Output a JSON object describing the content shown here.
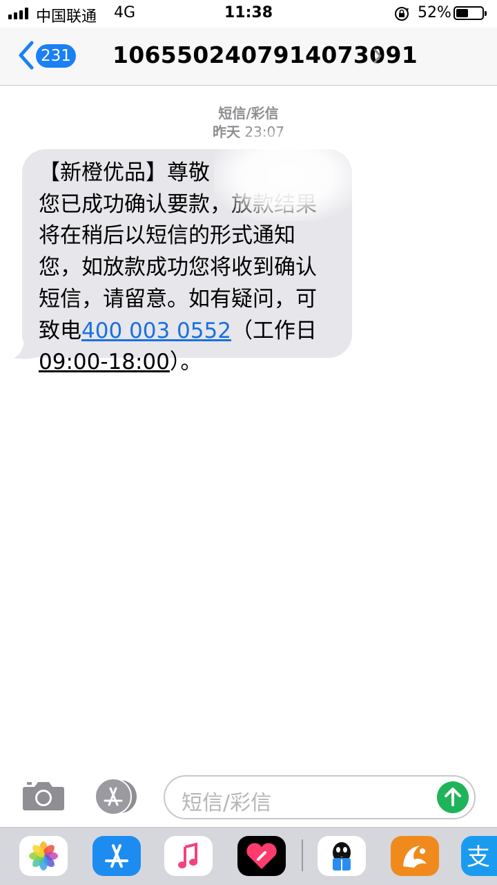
{
  "status_bar": {
    "carrier": "中国联通",
    "network": "4G",
    "time": "11:38",
    "battery_percent": "52%",
    "battery_level": 0.52,
    "icons": [
      "signal-icon",
      "orientation-lock-icon",
      "battery-icon"
    ]
  },
  "nav": {
    "back_count": "231",
    "title": "10655024079140730​91",
    "title_plain": "1065502407914073091",
    "icons": [
      "back-chevron-icon",
      "chevron-right-icon"
    ]
  },
  "thread": {
    "type": "短信/彩信",
    "day": "昨天",
    "time": "23:07"
  },
  "message": {
    "line1": "【新橙优品】尊敬",
    "line2": "您已成功确认要款，放款结果",
    "line3": "将在稍后以短信的形式通知",
    "line4": "您，如放款成功您将收到确认",
    "line5": "短信，请留意。如有疑问，可",
    "line6_pre": "致电",
    "phone": "400 003 0552",
    "line6_post": "（工作日",
    "hours": "09:00-18:00",
    "line7_post": "）。"
  },
  "composer": {
    "placeholder": "短信/彩信",
    "icons": [
      "camera-icon",
      "app-store-icon",
      "send-arrow-icon"
    ]
  },
  "app_drawer": {
    "apps": [
      "photos-icon",
      "app-store-icon",
      "music-icon",
      "digital-touch-icon",
      "qq-icon",
      "uc-browser-icon",
      "alipay-icon"
    ],
    "alipay_glyph": "支"
  },
  "colors": {
    "accent_blue": "#1a80f4",
    "link_blue": "#1a6fe0",
    "send_green": "#1fb45a",
    "bubble_gray": "#e6e6eb"
  }
}
